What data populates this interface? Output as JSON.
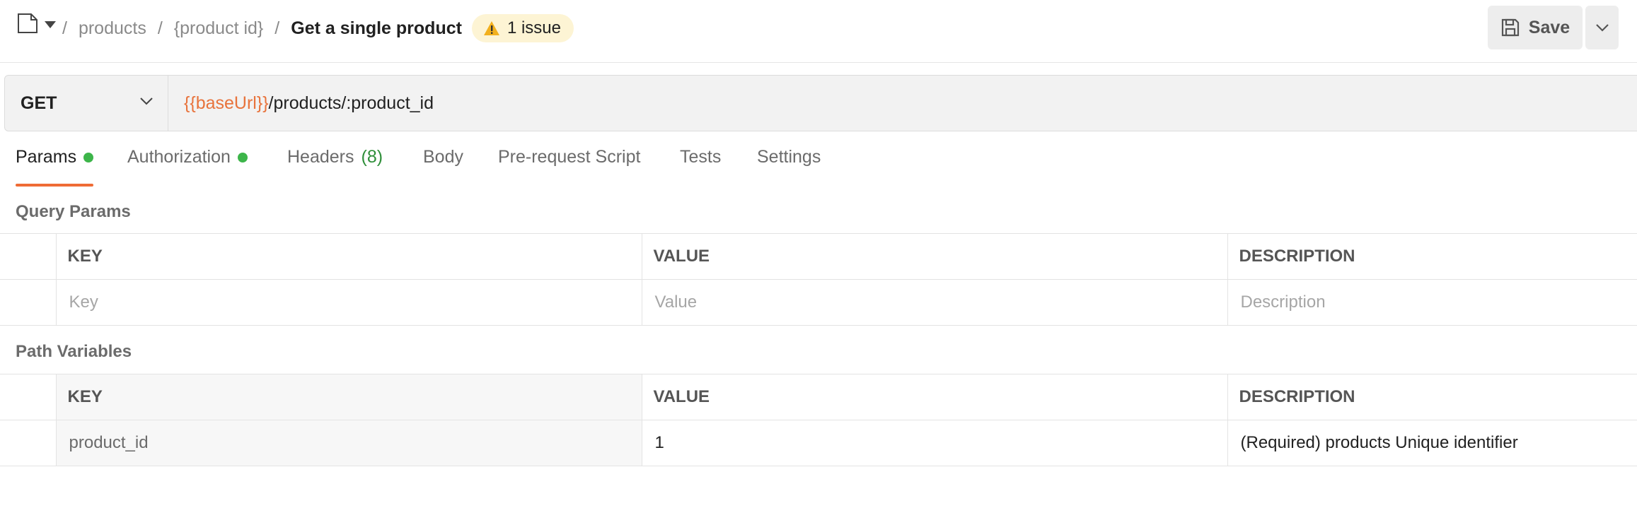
{
  "breadcrumb": {
    "items": [
      "products",
      "{product id}"
    ],
    "separator": "/",
    "current": "Get a single product"
  },
  "issue_badge": {
    "icon": "warning-icon",
    "label": "1 issue"
  },
  "toolbar": {
    "save_label": "Save",
    "save_icon": "floppy-disk-icon",
    "more_icon": "chevron-down-icon"
  },
  "request": {
    "method": "GET",
    "url_variable": "{{baseUrl}}",
    "url_path": "/products/:product_id"
  },
  "tabs": [
    {
      "label": "Params",
      "dot": true,
      "active": true
    },
    {
      "label": "Authorization",
      "dot": true
    },
    {
      "label": "Headers",
      "count": "(8)"
    },
    {
      "label": "Body"
    },
    {
      "label": "Pre-request Script"
    },
    {
      "label": "Tests"
    },
    {
      "label": "Settings"
    }
  ],
  "query_params": {
    "title": "Query Params",
    "columns": [
      "KEY",
      "VALUE",
      "DESCRIPTION"
    ],
    "placeholders": {
      "key": "Key",
      "value": "Value",
      "description": "Description"
    }
  },
  "path_variables": {
    "title": "Path Variables",
    "columns": [
      "KEY",
      "VALUE",
      "DESCRIPTION"
    ],
    "rows": [
      {
        "key": "product_id",
        "value": "1",
        "description": "(Required) products Unique identifier"
      }
    ]
  },
  "colors": {
    "accent": "#ef6c35",
    "url_variable": "#e8733c",
    "status_dot": "#3db54a",
    "badge_bg": "#fdf4d4"
  }
}
